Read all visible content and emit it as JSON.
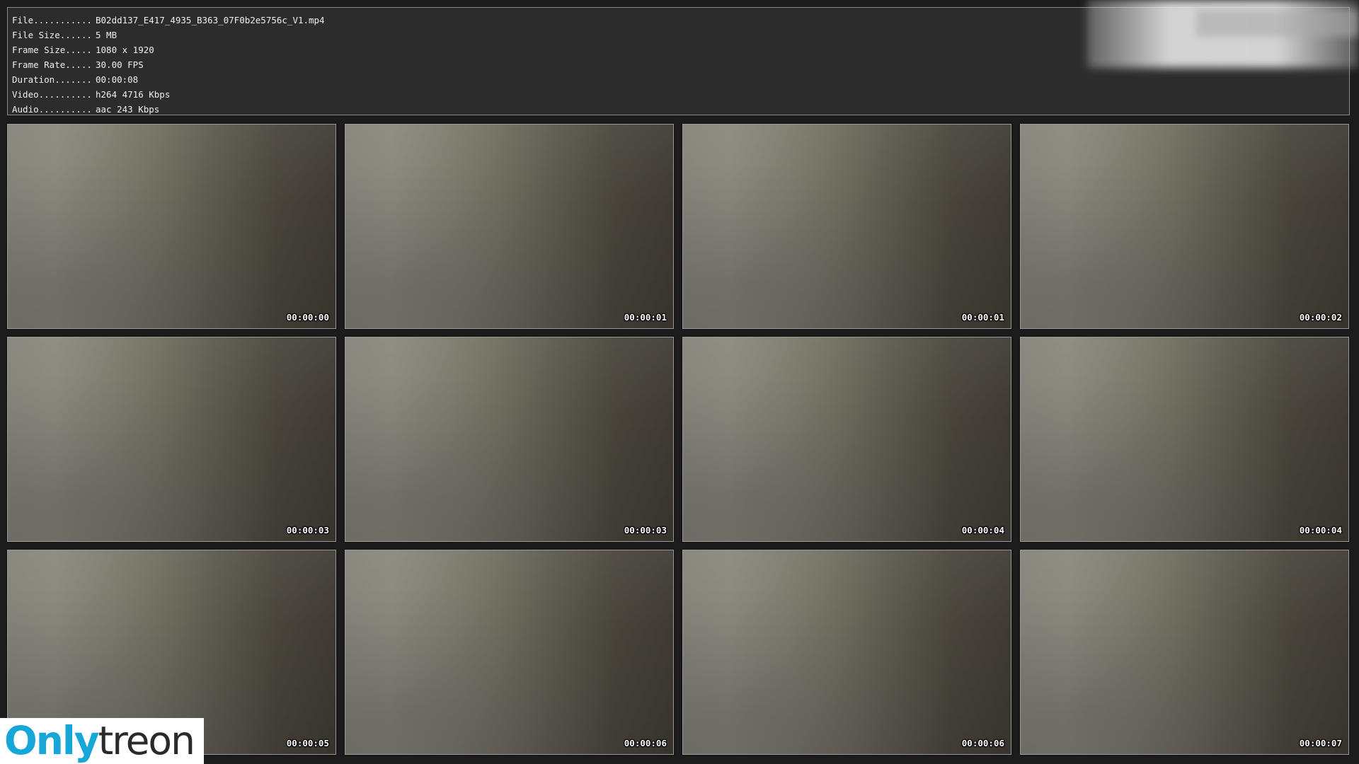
{
  "info": [
    {
      "label": "File...........",
      "value": "B02dd137_E417_4935_B363_07F0b2e5756c_V1.mp4"
    },
    {
      "label": "File Size......",
      "value": "5 MB"
    },
    {
      "label": "Frame Size.....",
      "value": "1080 x 1920"
    },
    {
      "label": "Frame Rate.....",
      "value": "30.00 FPS"
    },
    {
      "label": "Duration.......",
      "value": "00:00:08"
    },
    {
      "label": "Video..........",
      "value": "h264 4716 Kbps"
    },
    {
      "label": "Audio..........",
      "value": "aac 243 Kbps"
    }
  ],
  "thumbnails": [
    {
      "timestamp": "00:00:00"
    },
    {
      "timestamp": "00:00:01"
    },
    {
      "timestamp": "00:00:01"
    },
    {
      "timestamp": "00:00:02"
    },
    {
      "timestamp": "00:00:03"
    },
    {
      "timestamp": "00:00:03"
    },
    {
      "timestamp": "00:00:04"
    },
    {
      "timestamp": "00:00:04"
    },
    {
      "timestamp": "00:00:05"
    },
    {
      "timestamp": "00:00:06"
    },
    {
      "timestamp": "00:00:06"
    },
    {
      "timestamp": "00:00:07"
    }
  ],
  "watermark": {
    "part_a": "Only",
    "part_b": "treon",
    "colors": {
      "accent": "#16a7d8",
      "dark": "#2a2a2a"
    }
  }
}
